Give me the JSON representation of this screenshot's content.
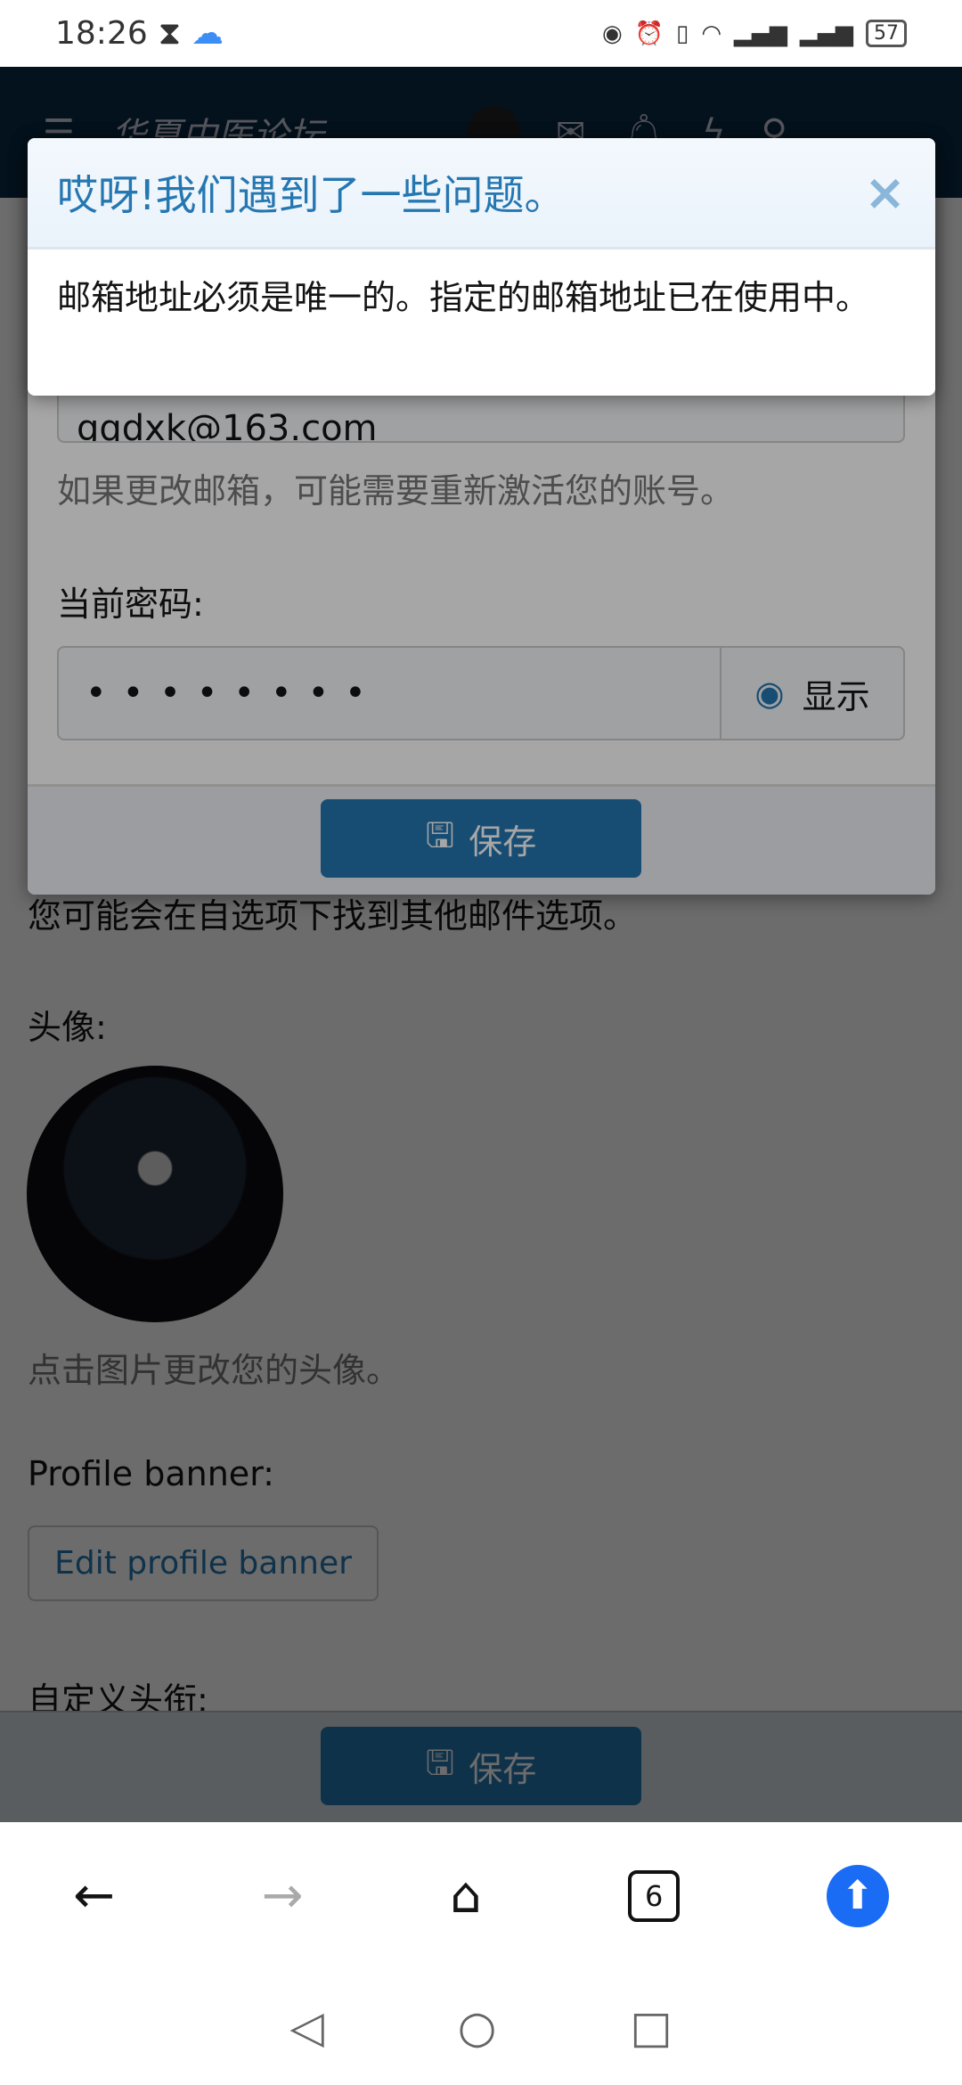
{
  "status": {
    "time": "18:26",
    "battery": "57",
    "icons": [
      "hourglass-icon",
      "cloud-icon",
      "eye-icon",
      "alarm-icon",
      "vibrate-icon",
      "wifi-icon",
      "signal-4g-icon",
      "signal-4g-icon",
      "battery-icon"
    ]
  },
  "header": {
    "logo": "华夏中医论坛"
  },
  "page": {
    "email_options_hint": "您可能会在自选项下找到其他邮件选项。",
    "avatar_label": "头像:",
    "avatar_hint": "点击图片更改您的头像。",
    "banner_label": "Profile banner:",
    "banner_button": "Edit profile banner",
    "title_label": "自定义头衔:",
    "save": "保存"
  },
  "modal": {
    "email_value": "gqdxk@163.com",
    "email_hint": "如果更改邮箱，可能需要重新激活您的账号。",
    "password_label": "当前密码:",
    "password_value": "••••••••",
    "show": "显示",
    "save": "保存"
  },
  "error": {
    "title": "哎呀!我们遇到了一些问题。",
    "message": "邮箱地址必须是唯一的。指定的邮箱地址已在使用中。",
    "close": "×"
  },
  "browser": {
    "tabs_count": "6"
  },
  "colors": {
    "accent": "#2577b1",
    "header": "#0c2b45",
    "upload": "#1a6cf5"
  }
}
